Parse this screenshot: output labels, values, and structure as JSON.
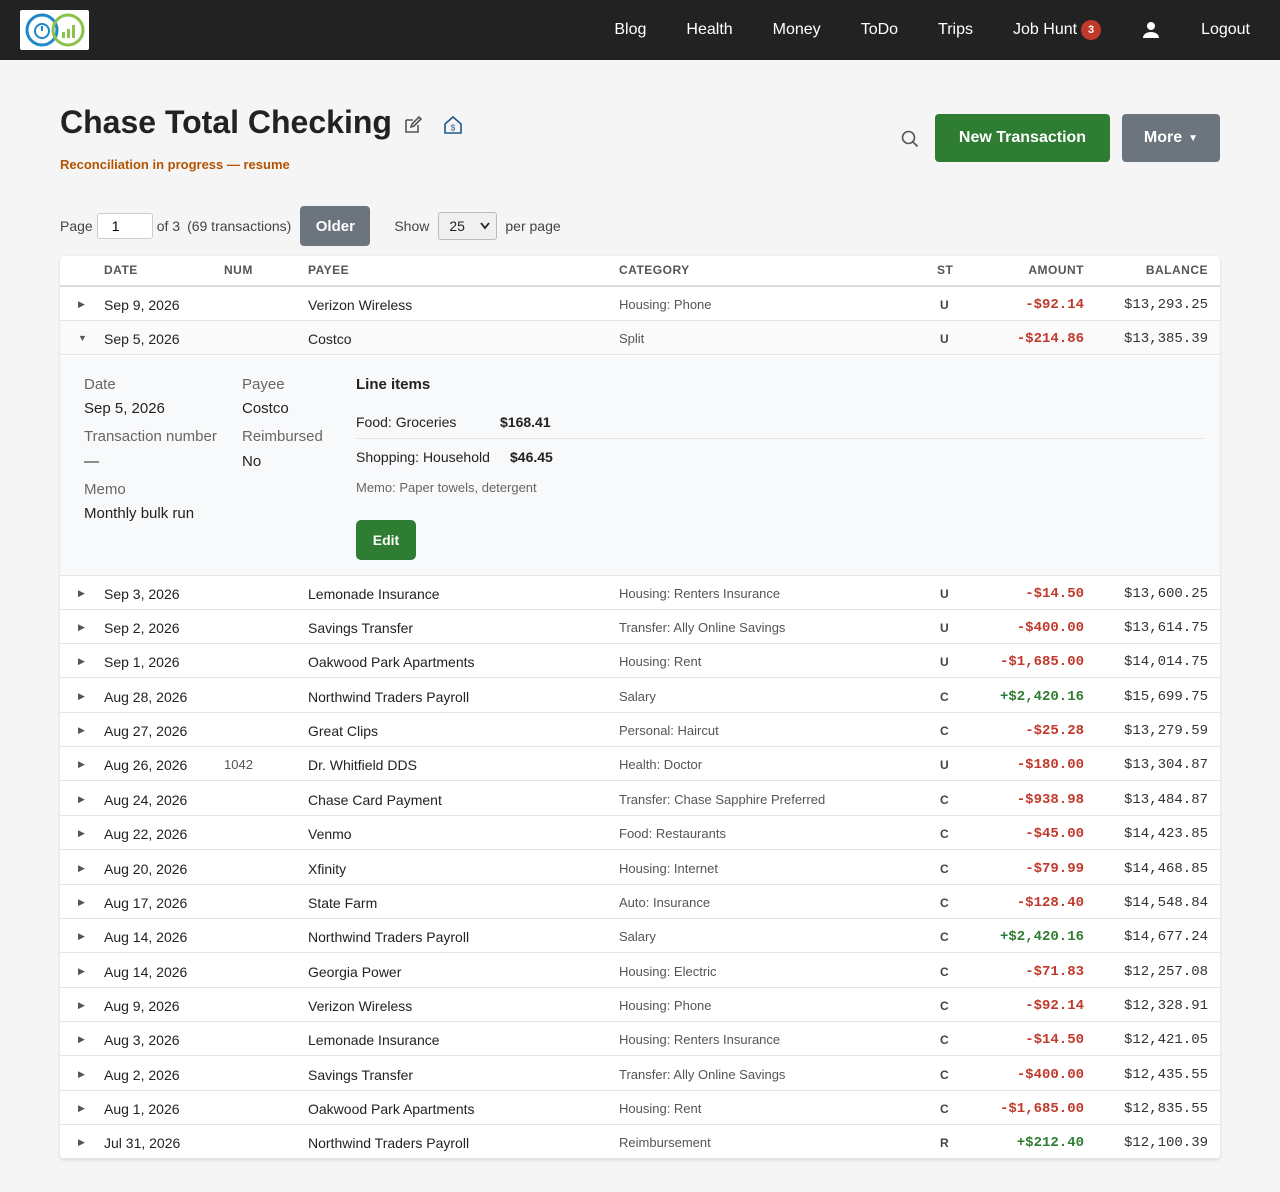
{
  "nav": {
    "items": [
      {
        "label": "Blog"
      },
      {
        "label": "Health"
      },
      {
        "label": "Money"
      },
      {
        "label": "ToDo"
      },
      {
        "label": "Trips"
      },
      {
        "label": "Job Hunt",
        "badge": "3"
      }
    ],
    "logout": "Logout",
    "user_icon": "user-icon"
  },
  "header": {
    "title": "Chase Total Checking",
    "edit_icon": "pencil-square-icon",
    "bank_icon": "bank-house-icon",
    "reconciliation": "Reconciliation in progress — resume",
    "search_icon": "search-icon",
    "new_transaction": "New Transaction",
    "more": "More"
  },
  "pager": {
    "page_label": "Page",
    "page_value": "1",
    "of_label": "of 3",
    "count": "(69 transactions)",
    "older": "Older",
    "show_label": "Show",
    "per_page_value": "25",
    "per_page_label": "per page"
  },
  "table": {
    "headers": {
      "date": "DATE",
      "num": "NUM",
      "payee": "PAYEE",
      "category": "CATEGORY",
      "st": "ST",
      "amount": "AMOUNT",
      "balance": "BALANCE"
    },
    "rows": [
      {
        "date": "Sep 9, 2026",
        "num": "",
        "payee": "Verizon Wireless",
        "category": "Housing: Phone",
        "st": "U",
        "amount": "-$92.14",
        "balance": "$13,293.25"
      },
      {
        "date": "Sep 5, 2026",
        "num": "",
        "payee": "Costco",
        "category": "Split",
        "st": "U",
        "amount": "-$214.86",
        "balance": "$13,385.39"
      },
      {
        "date": "Sep 3, 2026",
        "num": "",
        "payee": "Lemonade Insurance",
        "category": "Housing: Renters Insurance",
        "st": "U",
        "amount": "-$14.50",
        "balance": "$13,600.25"
      },
      {
        "date": "Sep 2, 2026",
        "num": "",
        "payee": "Savings Transfer",
        "category": "Transfer: Ally Online Savings",
        "st": "U",
        "amount": "-$400.00",
        "balance": "$13,614.75"
      },
      {
        "date": "Sep 1, 2026",
        "num": "",
        "payee": "Oakwood Park Apartments",
        "category": "Housing: Rent",
        "st": "U",
        "amount": "-$1,685.00",
        "balance": "$14,014.75"
      },
      {
        "date": "Aug 28, 2026",
        "num": "",
        "payee": "Northwind Traders Payroll",
        "category": "Salary",
        "st": "C",
        "amount": "+$2,420.16",
        "balance": "$15,699.75"
      },
      {
        "date": "Aug 27, 2026",
        "num": "",
        "payee": "Great Clips",
        "category": "Personal: Haircut",
        "st": "C",
        "amount": "-$25.28",
        "balance": "$13,279.59"
      },
      {
        "date": "Aug 26, 2026",
        "num": "1042",
        "payee": "Dr. Whitfield DDS",
        "category": "Health: Doctor",
        "st": "U",
        "amount": "-$180.00",
        "balance": "$13,304.87"
      },
      {
        "date": "Aug 24, 2026",
        "num": "",
        "payee": "Chase Card Payment",
        "category": "Transfer: Chase Sapphire Preferred",
        "st": "C",
        "amount": "-$938.98",
        "balance": "$13,484.87"
      },
      {
        "date": "Aug 22, 2026",
        "num": "",
        "payee": "Venmo",
        "category": "Food: Restaurants",
        "st": "C",
        "amount": "-$45.00",
        "balance": "$14,423.85"
      },
      {
        "date": "Aug 20, 2026",
        "num": "",
        "payee": "Xfinity",
        "category": "Housing: Internet",
        "st": "C",
        "amount": "-$79.99",
        "balance": "$14,468.85"
      },
      {
        "date": "Aug 17, 2026",
        "num": "",
        "payee": "State Farm",
        "category": "Auto: Insurance",
        "st": "C",
        "amount": "-$128.40",
        "balance": "$14,548.84"
      },
      {
        "date": "Aug 14, 2026",
        "num": "",
        "payee": "Northwind Traders Payroll",
        "category": "Salary",
        "st": "C",
        "amount": "+$2,420.16",
        "balance": "$14,677.24"
      },
      {
        "date": "Aug 14, 2026",
        "num": "",
        "payee": "Georgia Power",
        "category": "Housing: Electric",
        "st": "C",
        "amount": "-$71.83",
        "balance": "$12,257.08"
      },
      {
        "date": "Aug 9, 2026",
        "num": "",
        "payee": "Verizon Wireless",
        "category": "Housing: Phone",
        "st": "C",
        "amount": "-$92.14",
        "balance": "$12,328.91"
      },
      {
        "date": "Aug 3, 2026",
        "num": "",
        "payee": "Lemonade Insurance",
        "category": "Housing: Renters Insurance",
        "st": "C",
        "amount": "-$14.50",
        "balance": "$12,421.05"
      },
      {
        "date": "Aug 2, 2026",
        "num": "",
        "payee": "Savings Transfer",
        "category": "Transfer: Ally Online Savings",
        "st": "C",
        "amount": "-$400.00",
        "balance": "$12,435.55"
      },
      {
        "date": "Aug 1, 2026",
        "num": "",
        "payee": "Oakwood Park Apartments",
        "category": "Housing: Rent",
        "st": "C",
        "amount": "-$1,685.00",
        "balance": "$12,835.55"
      },
      {
        "date": "Jul 31, 2026",
        "num": "",
        "payee": "Northwind Traders Payroll",
        "category": "Reimbursement",
        "st": "R",
        "amount": "+$212.40",
        "balance": "$12,100.39"
      }
    ]
  },
  "detail": {
    "date_label": "Date",
    "date_value": "Sep 5, 2026",
    "txn_label": "Transaction number",
    "txn_value": "—",
    "memo_label": "Memo",
    "memo_value": "Monthly bulk run",
    "payee_label": "Payee",
    "payee_value": "Costco",
    "reimbursed_label": "Reimbursed",
    "reimbursed_value": "No",
    "line_items_heading": "Line items",
    "line_items": [
      {
        "category": "Food: Groceries",
        "amount": "$168.41"
      },
      {
        "category": "Shopping: Household",
        "amount": "$46.45"
      }
    ],
    "memo_line": "Memo: Paper towels, detergent",
    "edit": "Edit"
  },
  "colors": {
    "nav_bg": "#222222",
    "accent_green": "#2e7d32",
    "negative": "#c0392b",
    "more_gray": "#6c757d",
    "warning": "#b35400"
  }
}
